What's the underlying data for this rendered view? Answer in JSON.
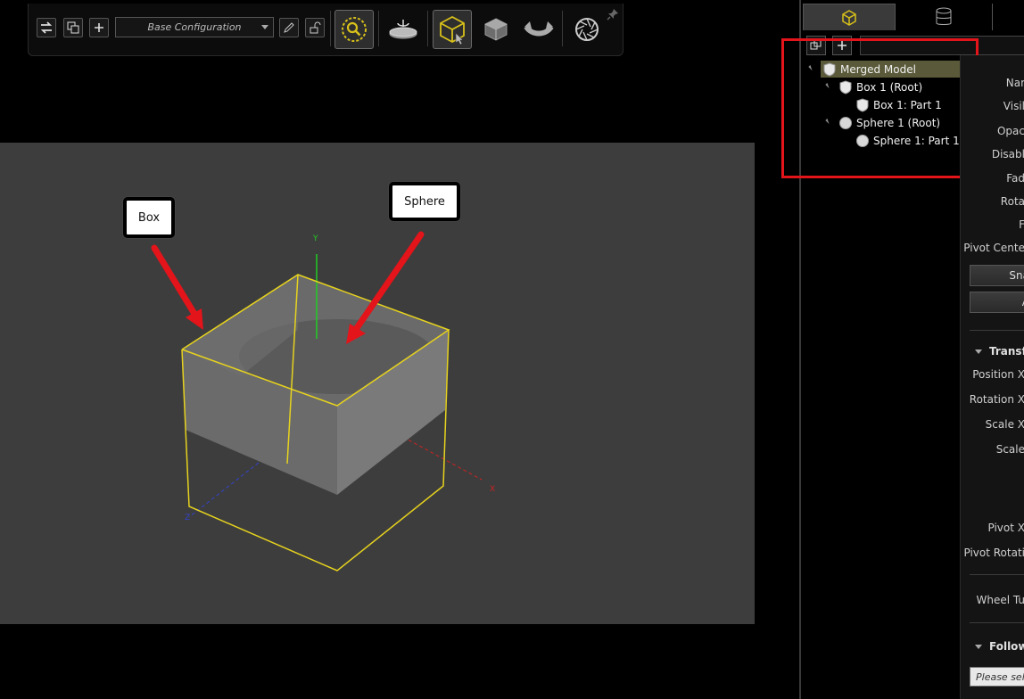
{
  "toolbar": {
    "configuration": "Base Configuration",
    "icons": [
      "swap-icon",
      "copy-icon",
      "add-icon",
      "edit-icon",
      "unlock-icon",
      "zoom-search-icon",
      "turntable-icon",
      "select-box-icon",
      "object-3d-icon",
      "rotate-icon",
      "aperture-icon",
      "pin-icon"
    ]
  },
  "viewport": {
    "callout_box": "Box",
    "callout_sphere": "Sphere",
    "axis_x": "X",
    "axis_y": "Y",
    "axis_z": "Z",
    "colors": {
      "background": "#3d3d3d",
      "selection": "#e6d21e",
      "arrow": "#e3141a",
      "x_axis": "#cc2222",
      "y_axis": "#22cc22",
      "z_axis": "#3344cc"
    }
  },
  "tree": {
    "items": [
      {
        "label": "Merged Model",
        "icon": "shield-icon"
      },
      {
        "label": "Box 1 (Root)",
        "icon": "shield-icon"
      },
      {
        "label": "Box 1: Part 1",
        "icon": "shield-icon"
      },
      {
        "label": "Sphere 1 (Root)",
        "icon": "sphere-icon"
      },
      {
        "label": "Sphere 1: Part 1",
        "icon": "sphere-icon"
      }
    ]
  },
  "properties": {
    "labels": [
      "Nar",
      "Visil",
      "Opac",
      "Disabl",
      "Fad",
      "Rota",
      "F",
      "Pivot Cente"
    ],
    "buttons": [
      "Sna",
      "A"
    ],
    "section_transform": "Transf",
    "transform_labels": [
      "Position X",
      "Rotation X",
      "Scale X",
      "Scale"
    ],
    "pivot_labels": [
      "Pivot X",
      "Pivot Rotati"
    ],
    "wheel_label": "Wheel Tu",
    "section_follow": "Follow",
    "select_placeholder": "Please selec"
  }
}
